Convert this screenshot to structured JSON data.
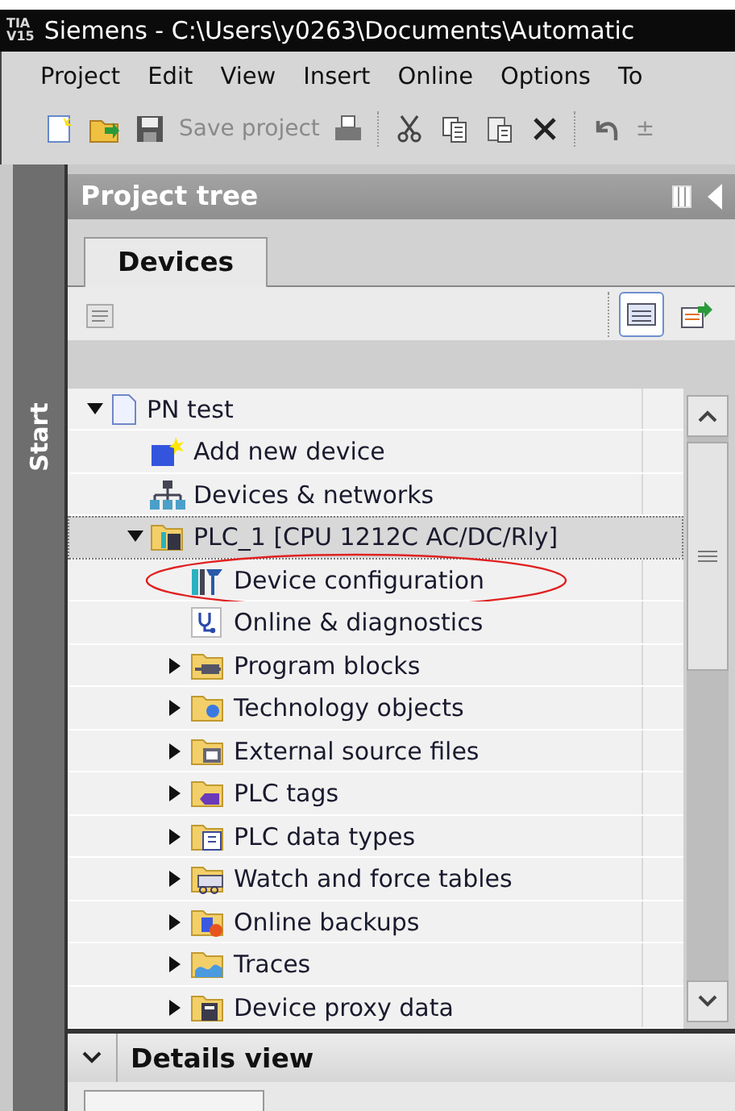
{
  "title_bar": {
    "logo": [
      "TIA",
      "V15"
    ],
    "title": "Siemens  -  C:\\Users\\y0263\\Documents\\Automatic"
  },
  "menu": [
    "Project",
    "Edit",
    "View",
    "Insert",
    "Online",
    "Options",
    "To"
  ],
  "toolbar": [
    {
      "kind": "new"
    },
    {
      "kind": "open"
    },
    {
      "kind": "save"
    },
    {
      "kind": "label",
      "label": "Save project",
      "disabled": true
    },
    {
      "kind": "print"
    },
    {
      "kind": "separator"
    },
    {
      "kind": "cut"
    },
    {
      "kind": "copy"
    },
    {
      "kind": "paste"
    },
    {
      "kind": "delete"
    },
    {
      "kind": "separator"
    },
    {
      "kind": "undo"
    },
    {
      "kind": "label",
      "label": "±",
      "disabled": true
    }
  ],
  "side_rail": {
    "label": "Start"
  },
  "project_tree": {
    "title": "Project tree",
    "tabs": [
      {
        "label": "Devices",
        "selected": true
      }
    ],
    "view_buttons": [
      {
        "kind": "list",
        "selected": true
      },
      {
        "kind": "export",
        "selected": false
      }
    ],
    "items": [
      {
        "label": "PN test",
        "selected": false,
        "expanded": true,
        "children": [
          {
            "label": "Add new device",
            "selected": false
          },
          {
            "label": "Devices & networks",
            "selected": false
          },
          {
            "label": "PLC_1 [CPU 1212C AC/DC/Rly]",
            "selected": true,
            "expanded": true,
            "children": [
              {
                "label": "Device configuration",
                "selected": false,
                "circled": true
              },
              {
                "label": "Online & diagnostics",
                "selected": false
              },
              {
                "label": "Program blocks",
                "selected": false,
                "expanded": false
              },
              {
                "label": "Technology objects",
                "selected": false,
                "expanded": false
              },
              {
                "label": "External source files",
                "selected": false,
                "expanded": false
              },
              {
                "label": "PLC tags",
                "selected": false,
                "expanded": false
              },
              {
                "label": "PLC data types",
                "selected": false,
                "expanded": false
              },
              {
                "label": "Watch and force tables",
                "selected": false,
                "expanded": false
              },
              {
                "label": "Online backups",
                "selected": false,
                "expanded": false
              },
              {
                "label": "Traces",
                "selected": false,
                "expanded": false
              },
              {
                "label": "Device proxy data",
                "selected": false,
                "expanded": false
              }
            ]
          }
        ]
      }
    ]
  },
  "details_view": {
    "title": "Details view",
    "expanded": true
  }
}
